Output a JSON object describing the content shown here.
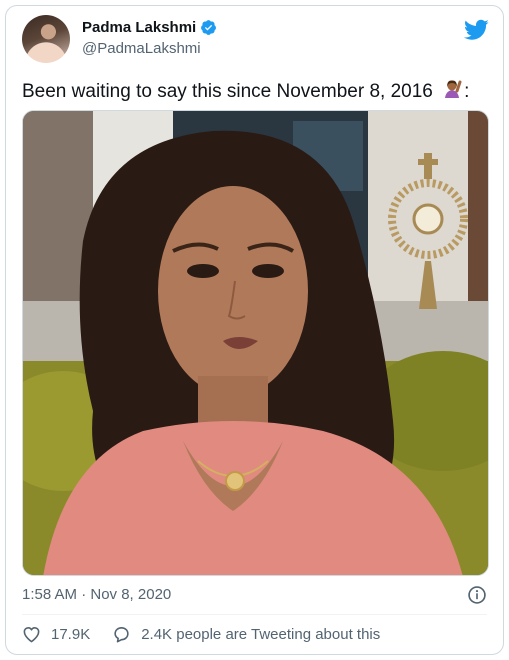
{
  "tweet": {
    "author": {
      "display_name": "Padma Lakshmi",
      "handle": "@PadmaLakshmi",
      "verified": true,
      "avatar": "profile-photo"
    },
    "text": "Been waiting to say this since November 8, 2016",
    "emoji": "woman-raising-hand-emoji",
    "emoji_suffix": ":",
    "media": {
      "type": "video-still",
      "icon": "video-frame"
    },
    "timestamp": "1:58 AM · Nov 8, 2020",
    "likes": "17.9K",
    "retweet_text": "2.4K people are Tweeting about this"
  },
  "icons": {
    "brand": "twitter-bird-icon",
    "verified": "verified-badge-icon",
    "info": "info-icon",
    "like": "heart-icon",
    "reply": "speech-bubble-icon"
  },
  "colors": {
    "brand_blue": "#1d9bf0",
    "text": "#0f1419",
    "muted": "#536471",
    "border": "#cfd9de"
  }
}
